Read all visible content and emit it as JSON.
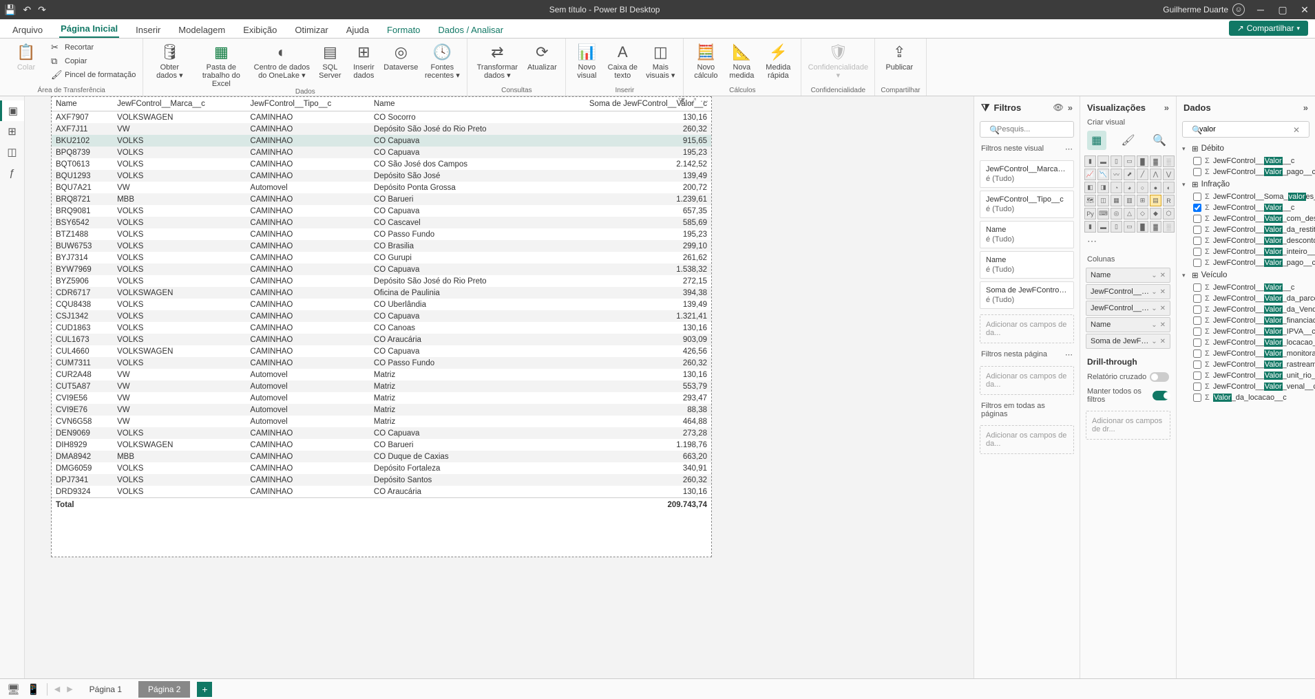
{
  "titlebar": {
    "title": "Sem título - Power BI Desktop",
    "user": "Guilherme Duarte"
  },
  "ribbon": {
    "tabs": [
      "Arquivo",
      "Página Inicial",
      "Inserir",
      "Modelagem",
      "Exibição",
      "Otimizar",
      "Ajuda",
      "Formato",
      "Dados / Analisar"
    ],
    "active_tab": "Página Inicial",
    "context_tabs": [
      "Formato",
      "Dados / Analisar"
    ],
    "share": "Compartilhar",
    "clipboard": {
      "paste": "Colar",
      "cut": "Recortar",
      "copy": "Copiar",
      "fmt": "Pincel de formatação",
      "title": "Área de Transferência"
    },
    "data_group": {
      "get": "Obter dados",
      "excel": "Pasta de trabalho do Excel",
      "onelake": "Centro de dados do OneLake",
      "sql": "SQL Server",
      "enter": "Inserir dados",
      "dataverse": "Dataverse",
      "recent": "Fontes recentes",
      "title": "Dados"
    },
    "queries": {
      "transform": "Transformar dados",
      "refresh": "Atualizar",
      "title": "Consultas"
    },
    "insert": {
      "visual": "Novo visual",
      "textbox": "Caixa de texto",
      "more": "Mais visuais",
      "title": "Inserir"
    },
    "calc": {
      "measure": "Nova medida",
      "col": "Novo cálculo",
      "quick": "Medida rápida",
      "title": "Cálculos"
    },
    "sens": {
      "label": "Confidencialidade",
      "title": "Confidencialidade"
    },
    "share_g": {
      "publish": "Publicar",
      "title": "Compartilhar"
    }
  },
  "table": {
    "columns": [
      "Name",
      "JewFControl__Marca__c",
      "JewFControl__Tipo__c",
      "Name",
      "Soma de JewFControl__Valor__c"
    ],
    "rows": [
      [
        "AXF7907",
        "VOLKSWAGEN",
        "CAMINHAO",
        "CO Socorro",
        "130,16"
      ],
      [
        "AXF7J11",
        "VW",
        "CAMINHAO",
        "Depósito São José do Rio Preto",
        "260,32"
      ],
      [
        "BKU2102",
        "VOLKS",
        "CAMINHAO",
        "CO Capuava",
        "915,65"
      ],
      [
        "BPQ8739",
        "VOLKS",
        "CAMINHAO",
        "CO Capuava",
        "195,23"
      ],
      [
        "BQT0613",
        "VOLKS",
        "CAMINHAO",
        "CO São José dos Campos",
        "2.142,52"
      ],
      [
        "BQU1293",
        "VOLKS",
        "CAMINHAO",
        "Depósito São José",
        "139,49"
      ],
      [
        "BQU7A21",
        "VW",
        "Automovel",
        "Depósito Ponta Grossa",
        "200,72"
      ],
      [
        "BRQ8721",
        "MBB",
        "CAMINHAO",
        "CO Barueri",
        "1.239,61"
      ],
      [
        "BRQ9081",
        "VOLKS",
        "CAMINHAO",
        "CO Capuava",
        "657,35"
      ],
      [
        "BSY6542",
        "VOLKS",
        "CAMINHAO",
        "CO Cascavel",
        "585,69"
      ],
      [
        "BTZ1488",
        "VOLKS",
        "CAMINHAO",
        "CO Passo Fundo",
        "195,23"
      ],
      [
        "BUW6753",
        "VOLKS",
        "CAMINHAO",
        "CO Brasilia",
        "299,10"
      ],
      [
        "BYJ7314",
        "VOLKS",
        "CAMINHAO",
        "CO Gurupi",
        "261,62"
      ],
      [
        "BYW7969",
        "VOLKS",
        "CAMINHAO",
        "CO Capuava",
        "1.538,32"
      ],
      [
        "BYZ5906",
        "VOLKS",
        "CAMINHAO",
        "Depósito São José do Rio Preto",
        "272,15"
      ],
      [
        "CDR6717",
        "VOLKSWAGEN",
        "CAMINHAO",
        "Oficina de Paulinia",
        "394,38"
      ],
      [
        "CQU8438",
        "VOLKS",
        "CAMINHAO",
        "CO Uberlândia",
        "139,49"
      ],
      [
        "CSJ1342",
        "VOLKS",
        "CAMINHAO",
        "CO Capuava",
        "1.321,41"
      ],
      [
        "CUD1863",
        "VOLKS",
        "CAMINHAO",
        "CO Canoas",
        "130,16"
      ],
      [
        "CUL1673",
        "VOLKS",
        "CAMINHAO",
        "CO Araucária",
        "903,09"
      ],
      [
        "CUL4660",
        "VOLKSWAGEN",
        "CAMINHAO",
        "CO Capuava",
        "426,56"
      ],
      [
        "CUM7311",
        "VOLKS",
        "CAMINHAO",
        "CO Passo Fundo",
        "260,32"
      ],
      [
        "CUR2A48",
        "VW",
        "Automovel",
        "Matriz",
        "130,16"
      ],
      [
        "CUT5A87",
        "VW",
        "Automovel",
        "Matriz",
        "553,79"
      ],
      [
        "CVI9E56",
        "VW",
        "Automovel",
        "Matriz",
        "293,47"
      ],
      [
        "CVI9E76",
        "VW",
        "Automovel",
        "Matriz",
        "88,38"
      ],
      [
        "CVN6G58",
        "VW",
        "Automovel",
        "Matriz",
        "464,88"
      ],
      [
        "DEN9069",
        "VOLKS",
        "CAMINHAO",
        "CO Capuava",
        "273,28"
      ],
      [
        "DIH8929",
        "VOLKSWAGEN",
        "CAMINHAO",
        "CO Barueri",
        "1.198,76"
      ],
      [
        "DMA8942",
        "MBB",
        "CAMINHAO",
        "CO Duque de Caxias",
        "663,20"
      ],
      [
        "DMG6059",
        "VOLKS",
        "CAMINHAO",
        "Depósito Fortaleza",
        "340,91"
      ],
      [
        "DPJ7341",
        "VOLKS",
        "CAMINHAO",
        "Depósito Santos",
        "260,32"
      ],
      [
        "DRD9324",
        "VOLKS",
        "CAMINHAO",
        "CO Araucária",
        "130,16"
      ]
    ],
    "highlight_row": 2,
    "total_label": "Total",
    "total_value": "209.743,74"
  },
  "filters": {
    "title": "Filtros",
    "search_ph": "Pesquis...",
    "sec_visual": "Filtros neste visual",
    "cards": [
      {
        "name": "JewFControl__Marca__c",
        "val": "é (Tudo)"
      },
      {
        "name": "JewFControl__Tipo__c",
        "val": "é (Tudo)"
      },
      {
        "name": "Name",
        "val": "é (Tudo)"
      },
      {
        "name": "Name",
        "val": "é (Tudo)"
      },
      {
        "name": "Soma de JewFControl__...",
        "val": "é (Tudo)"
      }
    ],
    "add_here": "Adicionar os campos de da...",
    "sec_page": "Filtros nesta página",
    "sec_all": "Filtros em todas as páginas"
  },
  "viz": {
    "title": "Visualizações",
    "subtitle": "Criar visual",
    "sec_cols": "Colunas",
    "wells": [
      "Name",
      "JewFControl__Marca__c",
      "JewFControl__Tipo__c",
      "Name",
      "Soma de JewFControl__..."
    ],
    "drill": "Drill-through",
    "cross": "Relatório cruzado",
    "keep": "Manter todos os filtros",
    "add_drill": "Adicionar os campos de dr..."
  },
  "data": {
    "title": "Dados",
    "search_value": "valor",
    "groups": [
      {
        "name": "Débito",
        "fields": [
          {
            "name": "JewFControl__Valor__c",
            "checked": false
          },
          {
            "name": "JewFControl__Valor_pago__c",
            "checked": false
          }
        ]
      },
      {
        "name": "Infração",
        "fields": [
          {
            "name": "JewFControl__Soma_valores__c",
            "checked": false,
            "hl": "valor",
            "pre": "JewFControl__Soma_",
            "post": "es__c"
          },
          {
            "name": "JewFControl__Valor__c",
            "checked": true
          },
          {
            "name": "JewFControl__Valor_com_desconto...",
            "checked": false
          },
          {
            "name": "JewFControl__Valor_da_restituicao__...",
            "checked": false
          },
          {
            "name": "JewFControl__Valor_desconto__c",
            "checked": false
          },
          {
            "name": "JewFControl__Valor_inteiro__c",
            "checked": false
          },
          {
            "name": "JewFControl__Valor_pago__c",
            "checked": false
          }
        ]
      },
      {
        "name": "Veículo",
        "fields": [
          {
            "name": "JewFControl__Valor__c",
            "checked": false
          },
          {
            "name": "JewFControl__Valor_da_parcela_fina...",
            "checked": false
          },
          {
            "name": "JewFControl__Valor_da_Venda__c",
            "checked": false
          },
          {
            "name": "JewFControl__Valor_financiado__c",
            "checked": false
          },
          {
            "name": "JewFControl__Valor_IPVA__c",
            "checked": false
          },
          {
            "name": "JewFControl__Valor_locacao__c",
            "checked": false
          },
          {
            "name": "JewFControl__Valor_monitorament...",
            "checked": false
          },
          {
            "name": "JewFControl__Valor_rastreamento__...",
            "checked": false
          },
          {
            "name": "JewFControl__Valor_unit_rio__c",
            "checked": false
          },
          {
            "name": "JewFControl__Valor_venal__c",
            "checked": false
          },
          {
            "name": "Valor_da_locacao__c",
            "checked": false,
            "hl": "Valor",
            "pre": "",
            "post": "_da_locacao__c"
          }
        ]
      }
    ]
  },
  "pages": {
    "tabs": [
      "Página 1",
      "Página 2"
    ],
    "active": 1
  }
}
